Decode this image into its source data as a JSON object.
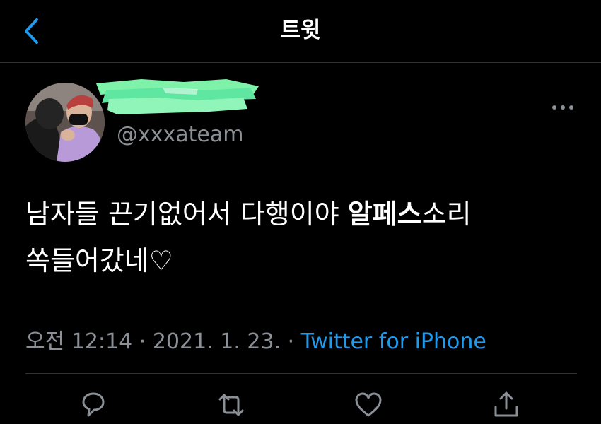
{
  "header": {
    "title": "트윗"
  },
  "author": {
    "handle": "@xxxateam"
  },
  "tweet": {
    "line1_part1": "남자들 끈기없어서 다행이야 ",
    "line1_bold": "알페스",
    "line1_part2": "소리",
    "line2": "쏙들어갔네♡"
  },
  "meta": {
    "time": "오전 12:14",
    "separator1": " · ",
    "date": "2021. 1. 23.",
    "separator2": " · ",
    "source": "Twitter for iPhone"
  },
  "colors": {
    "background": "#000000",
    "accent": "#1d9bf0",
    "secondary_text": "#8a9096",
    "divider": "#2f3336",
    "redaction": "#7df2a8"
  },
  "icons": {
    "back": "chevron-left-icon",
    "more": "more-dots-icon",
    "reply": "reply-icon",
    "retweet": "retweet-icon",
    "like": "heart-icon",
    "share": "share-icon"
  }
}
